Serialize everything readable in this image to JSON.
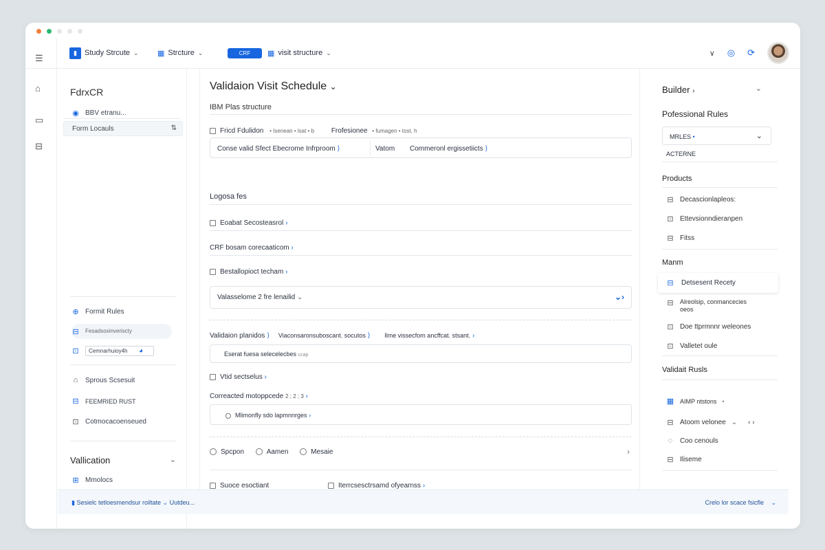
{
  "window_dots": [
    "#f0803c",
    "#2bb673",
    "#e4e6e9",
    "#e4e6e9",
    "#e4e6e9"
  ],
  "colors": {
    "accent": "#1766e0"
  },
  "topbar": {
    "study_structure_label": "Study Strcute",
    "structure_label": "Strcture",
    "crf_pill": "CRF",
    "visit_structure_label": "visit structure"
  },
  "left_panel": {
    "title": "FdrxCR",
    "search_text": "BBV etranu...",
    "form_locals": "Form Locauls",
    "items": [
      "Formit Rules",
      "Fesadsoxinveriscty",
      "Cemnarhuioy4h",
      "Sprous Scsesuit",
      "FEEMRIED RUST",
      "Cotmocacoenseued"
    ],
    "validation_title": "Vallication",
    "misc_item": "Mmolocs"
  },
  "main": {
    "title": "Validaion Visit Schedule",
    "subtitle": "IBM Plas structure",
    "field_row": {
      "field_label": "Fricd Fdulidon",
      "small1": "• Isenean • lsat • b",
      "professional": "Frofesionee",
      "small2": "• fumagen • tost, h"
    },
    "box1": {
      "text1": "Conse valid Sfect Ebecrome Infrproom",
      "text2": "Vatom",
      "text3": "Commeronl ergissetiicts"
    },
    "logout_label": "Logosa fes",
    "item1": "Eoabat Secosteasrol",
    "item2": "CRF bosam corecaaticom",
    "item3": "Bestallopioct techam",
    "select_value": "Valasselome 2 fre lenailid",
    "validation_row": {
      "label": "Validaion planidos",
      "mid": "Viaconsaronsuboscant. socutos",
      "right": "Ilme vissecfom ancffcat. stsant."
    },
    "box2_text": "Eserat fuesa selecelecbes",
    "box2_small": "ccap",
    "vital_label": "Vtid sectselus",
    "corrected_label": "Correacted motoppcede",
    "corrected_small": "2 ; 2 ; 3",
    "minim_text": "Mlimonfly sdo lapmnnrges",
    "radios": [
      "Spcpon",
      "Aamen",
      "Mesaie"
    ],
    "bottom_left": "Suoce esoctiant",
    "bottom_right": "Iterrcsesctrsamd ofyearnss"
  },
  "right_panel": {
    "builder_title": "Builder",
    "professional_rules": "Pofessional Rules",
    "dropdown_value": "MRLES",
    "actives_label": "ACTERNE",
    "products_title": "Products",
    "product_items": [
      "Decascionlapleos:",
      "Ettevsionndieranpen",
      "Fitss"
    ],
    "manm_title": "Manm",
    "manm_items": [
      "Detsesent Recety",
      "Alreolsip, conmancecies",
      "oeos",
      "Doe ttprmnnr weleones",
      "Valletet oule"
    ],
    "valid_rules_title": "Validait Rusls",
    "valid_items": [
      "AIMP ntstons",
      "Atoom velonee",
      "Coo cenouls",
      "Iliseme"
    ]
  },
  "footer": {
    "left_text": "Sesielc tetloesmendsur roiltate",
    "mid_text": "Uutdeu...",
    "right_text": "Crelo lor scace fsicfle"
  }
}
